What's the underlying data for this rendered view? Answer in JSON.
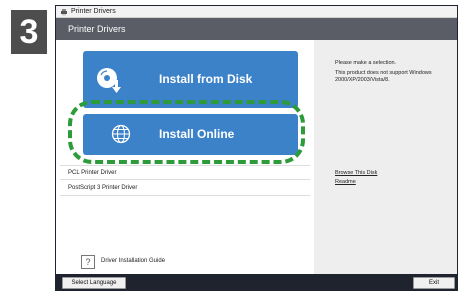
{
  "step_number": "3",
  "window": {
    "title": "Printer Drivers"
  },
  "header": {
    "title": "Printer Drivers"
  },
  "left": {
    "install_disk_label": "Install from Disk",
    "install_online_label": "Install Online",
    "drivers": [
      {
        "label": "PCL Printer Driver"
      },
      {
        "label": "PostScript 3 Printer Driver"
      }
    ],
    "guide_label": "Driver Installation Guide",
    "guide_icon_text": "?"
  },
  "right": {
    "prompt": "Please make a selection.",
    "note": "This product does not support Windows 2000/XP/2003/Vista/8.",
    "links": [
      {
        "label": "Browse This Disk"
      },
      {
        "label": "Readme"
      }
    ]
  },
  "footer": {
    "select_language_label": "Select Language",
    "exit_label": "Exit"
  },
  "colors": {
    "button_blue": "#3b82c9",
    "highlight_green": "#2d9b3a",
    "header_gray": "#5a5d66",
    "footer_dark": "#1f232d"
  },
  "icons": {
    "disk_button": "disc-download-icon",
    "online_button": "globe-icon",
    "guide": "question-icon",
    "app": "printer-icon"
  }
}
